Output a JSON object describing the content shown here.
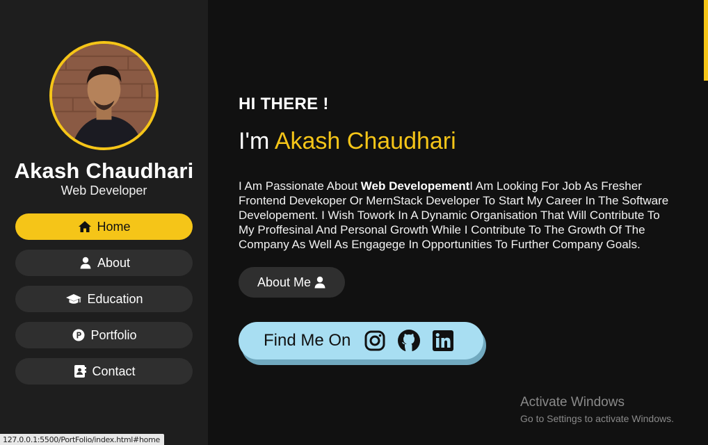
{
  "profile": {
    "name": "Akash Chaudhari",
    "role": "Web Developer"
  },
  "nav": {
    "items": [
      {
        "label": "Home",
        "icon": "home-icon",
        "active": true
      },
      {
        "label": "About",
        "icon": "user-icon",
        "active": false
      },
      {
        "label": "Education",
        "icon": "graduation-cap-icon",
        "active": false
      },
      {
        "label": "Portfolio",
        "icon": "product-hunt-icon",
        "active": false
      },
      {
        "label": "Contact",
        "icon": "address-book-icon",
        "active": false
      }
    ]
  },
  "hero": {
    "greeting": "HI THERE !",
    "intro_prefix": "I'm",
    "intro_name": "Akash Chaudhari",
    "bio_before": "I Am Passionate About ",
    "bio_bold": "Web Developement",
    "bio_after": "I Am Looking For Job As Fresher Frontend Devekoper Or MernStack Developer To Start My Career In The Software Developement. I Wish Towork In A Dynamic Organisation That Will Contribute To My Proffesinal And Personal Growth While I Contribute To The Growth Of The Company As Well As Engagege In Opportunities To Further Company Goals.",
    "about_button": "About Me",
    "find_me": "Find Me On"
  },
  "social": [
    "instagram-icon",
    "github-icon",
    "linkedin-icon"
  ],
  "watermark": {
    "title": "Activate Windows",
    "subtitle": "Go to Settings to activate Windows."
  },
  "status_bar": {
    "url": "127.0.0.1:5500/PortFolio/index.html#home"
  },
  "colors": {
    "accent": "#f5c518",
    "sidebar_bg": "#1e1e1e",
    "main_bg": "#111111",
    "find_me_bg": "#a8def2"
  }
}
